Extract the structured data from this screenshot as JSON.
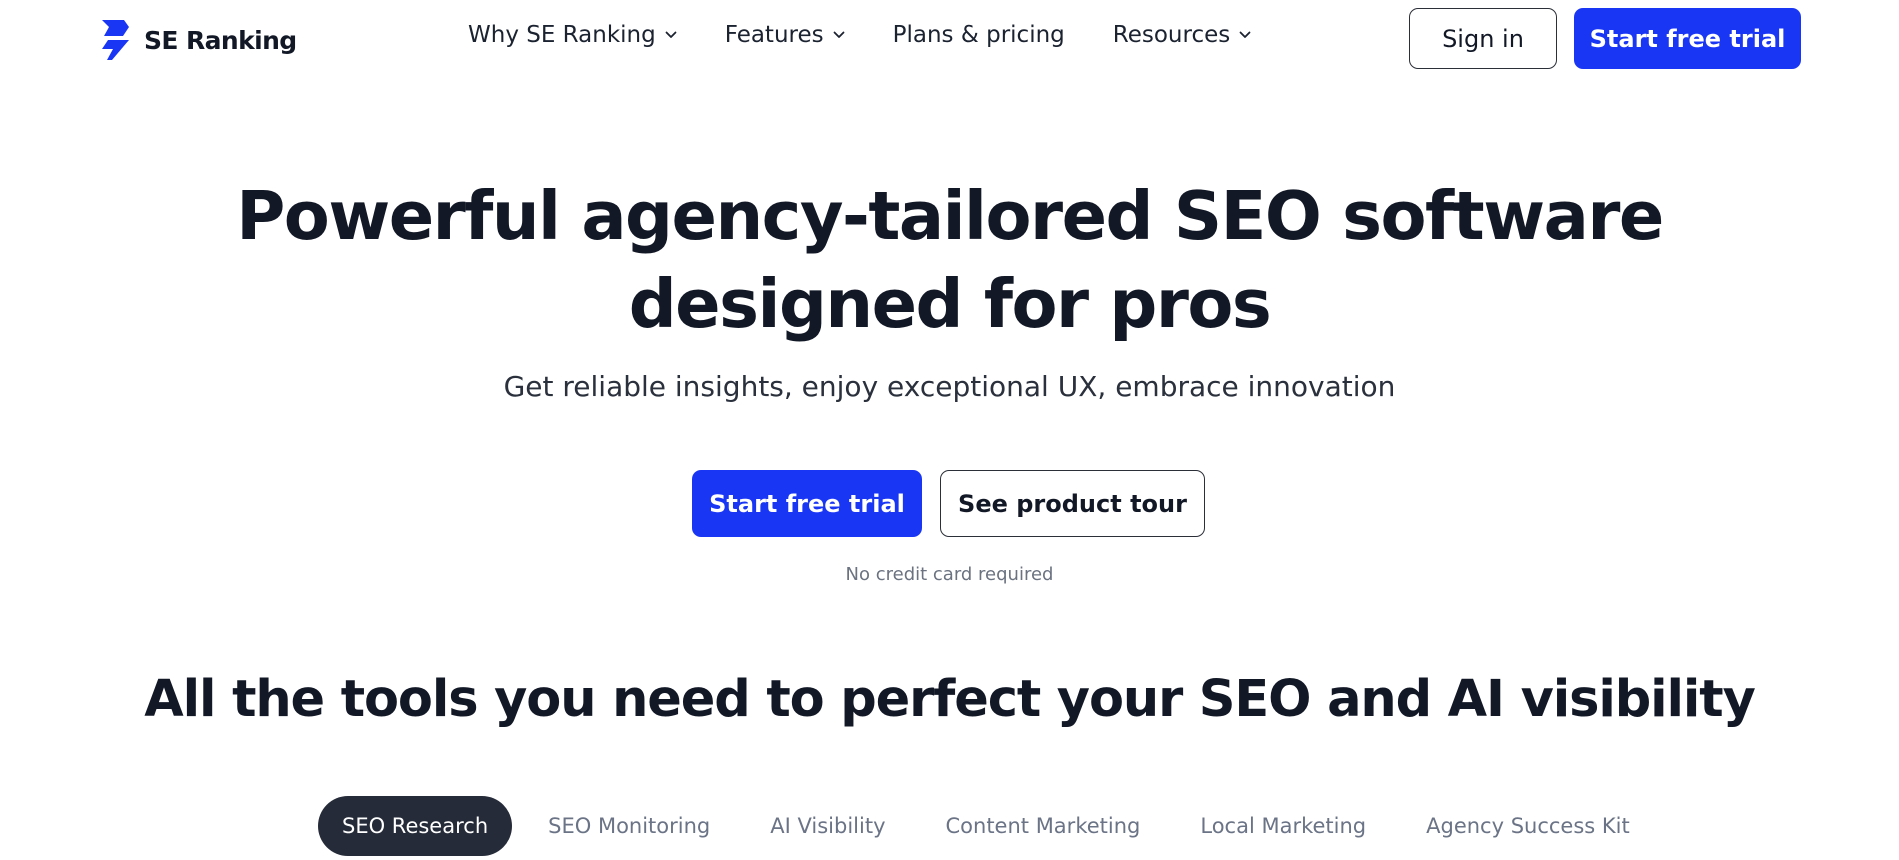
{
  "brand": {
    "name": "SE Ranking",
    "accent": "#1a36f5",
    "dark": "#121826"
  },
  "nav": {
    "items": [
      {
        "label": "Why SE Ranking",
        "dropdown": true
      },
      {
        "label": "Features",
        "dropdown": true
      },
      {
        "label": "Plans & pricing",
        "dropdown": false
      },
      {
        "label": "Resources",
        "dropdown": true
      }
    ],
    "sign_in": "Sign in",
    "start_trial": "Start free trial"
  },
  "hero": {
    "title_line1": "Powerful agency-tailored SEO software",
    "title_line2": "designed for pros",
    "subtitle": "Get reliable insights, enjoy exceptional UX, embrace innovation",
    "primary_cta": "Start free trial",
    "secondary_cta": "See product tour",
    "note": "No credit card required"
  },
  "tools": {
    "title": "All the tools you need to perfect your SEO and AI visibility",
    "tabs": [
      {
        "label": "SEO Research",
        "active": true
      },
      {
        "label": "SEO Monitoring",
        "active": false
      },
      {
        "label": "AI Visibility",
        "active": false
      },
      {
        "label": "Content Marketing",
        "active": false
      },
      {
        "label": "Local Marketing",
        "active": false
      },
      {
        "label": "Agency Success Kit",
        "active": false
      }
    ]
  },
  "icons": {
    "logo": "se-ranking-logo-icon",
    "dropdown": "chevron-down-icon"
  }
}
